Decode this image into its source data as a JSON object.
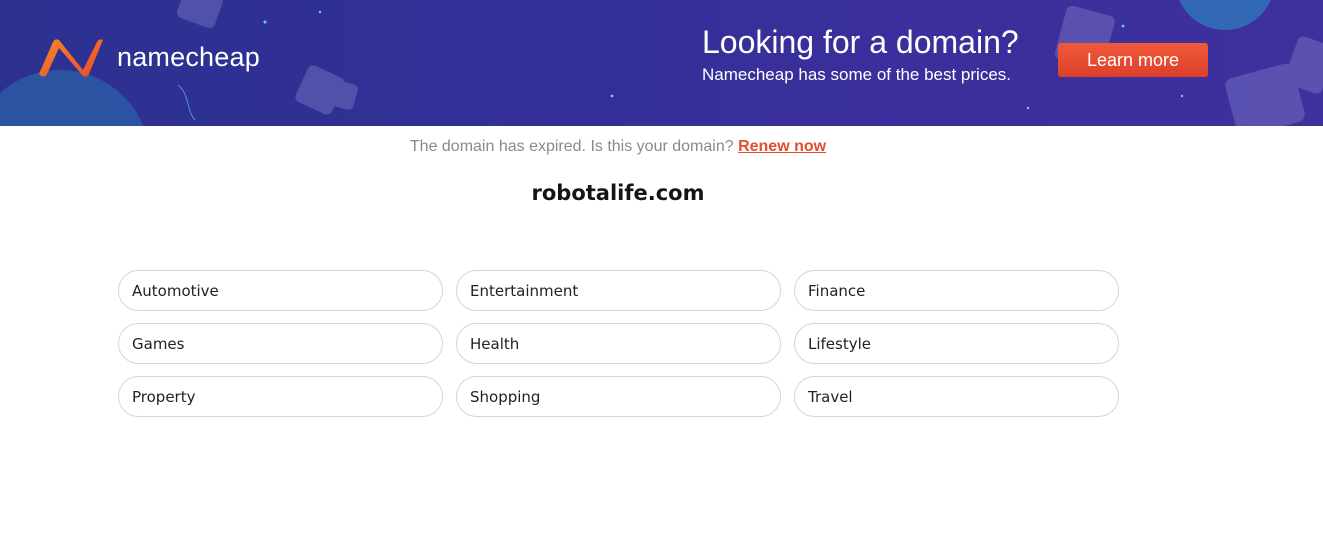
{
  "banner": {
    "brand": "namecheap",
    "title": "Looking for a domain?",
    "subtitle": "Namecheap has some of the best prices.",
    "cta_label": "Learn more",
    "colors": {
      "background": "#342f98",
      "accent": "#e24e2d",
      "logo_orange": "#f36a2d"
    }
  },
  "notice": {
    "text": "The domain has expired. Is this your domain?",
    "link_label": "Renew now"
  },
  "domain": "robotalife.com",
  "categories": [
    "Automotive",
    "Entertainment",
    "Finance",
    "Games",
    "Health",
    "Lifestyle",
    "Property",
    "Shopping",
    "Travel"
  ]
}
